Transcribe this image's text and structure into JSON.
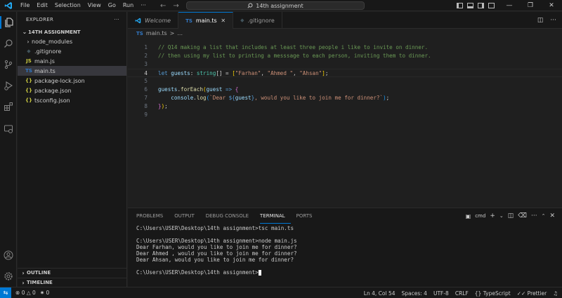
{
  "titlebar": {
    "menus": [
      "File",
      "Edit",
      "Selection",
      "View",
      "Go",
      "Run",
      "···"
    ],
    "search_text": "14th assignment"
  },
  "sidebar": {
    "header": "EXPLORER",
    "folder": "14TH ASSIGNMENT",
    "items": [
      {
        "label": "node_modules",
        "icon": "folder-chevron",
        "type": "folder"
      },
      {
        "label": ".gitignore",
        "icon": "git-ignore-icon",
        "glyph": "◆"
      },
      {
        "label": "main.js",
        "icon": "javascript-file-icon",
        "glyph": "JS"
      },
      {
        "label": "main.ts",
        "icon": "typescript-file-icon",
        "glyph": "TS",
        "selected": true
      },
      {
        "label": "package-lock.json",
        "icon": "json-file-icon",
        "glyph": "{}"
      },
      {
        "label": "package.json",
        "icon": "json-file-icon",
        "glyph": "{}"
      },
      {
        "label": "tsconfig.json",
        "icon": "json-file-icon",
        "glyph": "{}"
      }
    ],
    "outline": "OUTLINE",
    "timeline": "TIMELINE"
  },
  "tabs": [
    {
      "label": "Welcome",
      "icon": "vscode-icon",
      "active": false
    },
    {
      "label": "main.ts",
      "icon": "typescript-file-icon",
      "glyph": "TS",
      "active": true
    },
    {
      "label": ".gitignore",
      "icon": "git-ignore-icon",
      "glyph": "◆",
      "active": false
    }
  ],
  "breadcrumb": {
    "file_glyph": "TS",
    "file": "main.ts",
    "sep": ">",
    "more": "..."
  },
  "editor": {
    "lines": [
      {
        "n": "1",
        "parts": [
          {
            "t": "// Q14 making a list that includes at least three people i like to invite on dinner.",
            "c": "c-comment"
          }
        ]
      },
      {
        "n": "2",
        "parts": [
          {
            "t": "// then using my list to printing a messsage to each person, inviting them to dinner.",
            "c": "c-comment"
          }
        ]
      },
      {
        "n": "3",
        "parts": []
      },
      {
        "n": "4",
        "current": true,
        "parts": [
          {
            "t": "let ",
            "c": "c-kw"
          },
          {
            "t": "guests",
            "c": "c-var"
          },
          {
            "t": ": ",
            "c": "c-punc"
          },
          {
            "t": "string",
            "c": "c-type"
          },
          {
            "t": "[] = ",
            "c": "c-punc"
          },
          {
            "t": "[",
            "c": "c-br1"
          },
          {
            "t": "\"Farhan\"",
            "c": "c-str"
          },
          {
            "t": ", ",
            "c": "c-punc"
          },
          {
            "t": "\"Ahmed \"",
            "c": "c-str"
          },
          {
            "t": ", ",
            "c": "c-punc"
          },
          {
            "t": "\"Ahsan\"",
            "c": "c-str"
          },
          {
            "t": "]",
            "c": "c-br1"
          },
          {
            "t": ";",
            "c": "c-punc"
          }
        ]
      },
      {
        "n": "5",
        "parts": []
      },
      {
        "n": "6",
        "parts": [
          {
            "t": "guests",
            "c": "c-var"
          },
          {
            "t": ".",
            "c": "c-punc"
          },
          {
            "t": "forEach",
            "c": "c-fn"
          },
          {
            "t": "(",
            "c": "c-br1"
          },
          {
            "t": "guest",
            "c": "c-var"
          },
          {
            "t": " => ",
            "c": "c-kw"
          },
          {
            "t": "{",
            "c": "c-br2"
          }
        ]
      },
      {
        "n": "7",
        "parts": [
          {
            "t": "    console",
            "c": "c-var"
          },
          {
            "t": ".",
            "c": "c-punc"
          },
          {
            "t": "log",
            "c": "c-fn"
          },
          {
            "t": "(",
            "c": "c-br3"
          },
          {
            "t": "`Dear ",
            "c": "c-str"
          },
          {
            "t": "${",
            "c": "c-kw"
          },
          {
            "t": "guest",
            "c": "c-var"
          },
          {
            "t": "}",
            "c": "c-kw"
          },
          {
            "t": ", would you like to join me for dinner?`",
            "c": "c-str"
          },
          {
            "t": ")",
            "c": "c-br3"
          },
          {
            "t": ";",
            "c": "c-punc"
          }
        ]
      },
      {
        "n": "8",
        "parts": [
          {
            "t": "}",
            "c": "c-br2"
          },
          {
            "t": ")",
            "c": "c-br1"
          },
          {
            "t": ";",
            "c": "c-punc"
          }
        ]
      },
      {
        "n": "9",
        "parts": []
      }
    ]
  },
  "panel": {
    "tabs": [
      {
        "label": "PROBLEMS",
        "active": false
      },
      {
        "label": "OUTPUT",
        "active": false
      },
      {
        "label": "DEBUG CONSOLE",
        "active": false
      },
      {
        "label": "TERMINAL",
        "active": true
      },
      {
        "label": "PORTS",
        "active": false
      }
    ],
    "shell": "cmd",
    "terminal": [
      "C:\\Users\\USER\\Desktop\\14th assignment>tsc main.ts",
      "",
      "C:\\Users\\USER\\Desktop\\14th assignment>node main.js",
      "Dear Farhan, would you like to join me for dinner?",
      "Dear Ahmed , would you like to join me for dinner?",
      "Dear Ahsan, would you like to join me for dinner?",
      "",
      "C:\\Users\\USER\\Desktop\\14th assignment>"
    ]
  },
  "statusbar": {
    "errors": "0",
    "warnings": "0",
    "ports": "0",
    "position": "Ln 4, Col 54",
    "spaces": "Spaces: 4",
    "encoding": "UTF-8",
    "eol": "CRLF",
    "language": "TypeScript",
    "prettier": "Prettier"
  },
  "colors": {
    "accent": "#0078d4",
    "ts_icon": "#3178c6",
    "js_icon": "#cbcb41",
    "json_icon": "#cbcb41",
    "git_icon": "#41535b"
  }
}
